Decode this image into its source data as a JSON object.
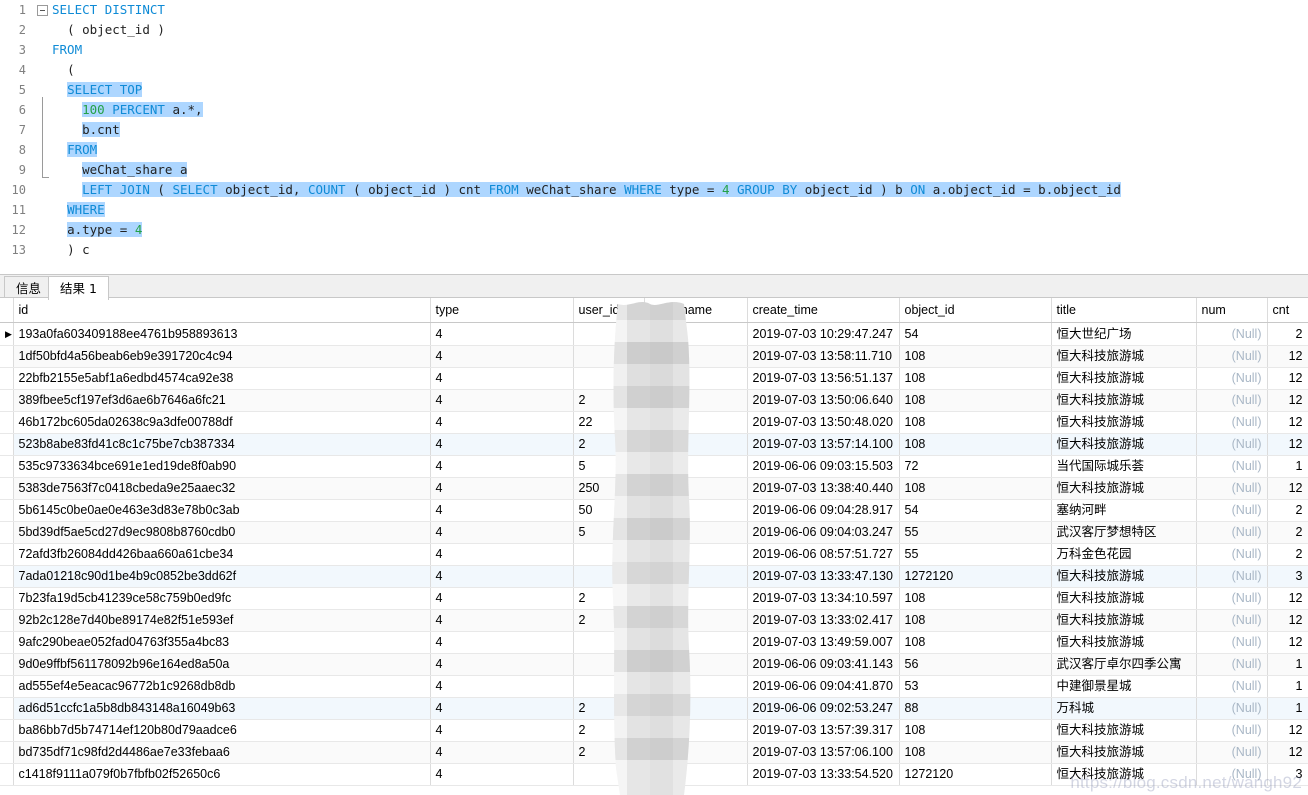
{
  "editor": {
    "language": "sql",
    "lines": [
      {
        "n": "1",
        "text": "SELECT DISTINCT"
      },
      {
        "n": "2",
        "text": "  ( object_id )"
      },
      {
        "n": "3",
        "text": "FROM"
      },
      {
        "n": "4",
        "text": "  ("
      },
      {
        "n": "5",
        "text": "  SELECT TOP"
      },
      {
        "n": "6",
        "text": "    100 PERCENT a.*,"
      },
      {
        "n": "7",
        "text": "    b.cnt"
      },
      {
        "n": "8",
        "text": "  FROM"
      },
      {
        "n": "9",
        "text": "    weChat_share a"
      },
      {
        "n": "10",
        "text": "    LEFT JOIN ( SELECT object_id, COUNT ( object_id ) cnt FROM weChat_share WHERE type = 4 GROUP BY object_id ) b ON a.object_id = b.object_id"
      },
      {
        "n": "11",
        "text": "  WHERE"
      },
      {
        "n": "12",
        "text": "  a.type = 4"
      },
      {
        "n": "13",
        "text": "  ) c"
      }
    ]
  },
  "tabs": [
    {
      "label": "信息",
      "active": false
    },
    {
      "label": "结果 1",
      "active": true
    }
  ],
  "grid": {
    "columns": [
      "id",
      "type",
      "user_id",
      "user_name",
      "create_time",
      "object_id",
      "title",
      "num",
      "cnt"
    ],
    "selected_column": "id",
    "current_row_marker": "▶",
    "null_text": "(Null)",
    "rows": [
      {
        "id": "193a0fa603409188ee4761b958893613",
        "type": "4",
        "user_id": "",
        "user_name": "",
        "create_time": "2019-07-03 10:29:47.247",
        "object_id": "54",
        "title": "恒大世纪广场",
        "num": "(Null)",
        "cnt": "2"
      },
      {
        "id": "1df50bfd4a56beab6eb9e391720c4c94",
        "type": "4",
        "user_id": "",
        "user_name": "",
        "create_time": "2019-07-03 13:58:11.710",
        "object_id": "108",
        "title": "恒大科技旅游城",
        "num": "(Null)",
        "cnt": "12"
      },
      {
        "id": "22bfb2155e5abf1a6edbd4574ca92e38",
        "type": "4",
        "user_id": "",
        "user_name": "",
        "create_time": "2019-07-03 13:56:51.137",
        "object_id": "108",
        "title": "恒大科技旅游城",
        "num": "(Null)",
        "cnt": "12"
      },
      {
        "id": "389fbee5cf197ef3d6ae6b7646a6fc21",
        "type": "4",
        "user_id": "2",
        "user_name": "",
        "create_time": "2019-07-03 13:50:06.640",
        "object_id": "108",
        "title": "恒大科技旅游城",
        "num": "(Null)",
        "cnt": "12"
      },
      {
        "id": "46b172bc605da02638c9a3dfe00788df",
        "type": "4",
        "user_id": "22",
        "user_name": "",
        "create_time": "2019-07-03 13:50:48.020",
        "object_id": "108",
        "title": "恒大科技旅游城",
        "num": "(Null)",
        "cnt": "12"
      },
      {
        "id": "523b8abe83fd41c8c1c75be7cb387334",
        "type": "4",
        "user_id": "2",
        "user_name": "",
        "create_time": "2019-07-03 13:57:14.100",
        "object_id": "108",
        "title": "恒大科技旅游城",
        "num": "(Null)",
        "cnt": "12"
      },
      {
        "id": "535c9733634bce691e1ed19de8f0ab90",
        "type": "4",
        "user_id": "5",
        "user_name": "",
        "create_time": "2019-06-06 09:03:15.503",
        "object_id": "72",
        "title": "当代国际城乐荟",
        "num": "(Null)",
        "cnt": "1"
      },
      {
        "id": "5383de7563f7c0418cbeda9e25aaec32",
        "type": "4",
        "user_id": "250",
        "user_name": "",
        "create_time": "2019-07-03 13:38:40.440",
        "object_id": "108",
        "title": "恒大科技旅游城",
        "num": "(Null)",
        "cnt": "12"
      },
      {
        "id": "5b6145c0be0ae0e463e3d83e78b0c3ab",
        "type": "4",
        "user_id": "50",
        "user_name": "",
        "create_time": "2019-06-06 09:04:28.917",
        "object_id": "54",
        "title": "塞纳河畔",
        "num": "(Null)",
        "cnt": "2"
      },
      {
        "id": "5bd39df5ae5cd27d9ec9808b8760cdb0",
        "type": "4",
        "user_id": "5",
        "user_name": "",
        "create_time": "2019-06-06 09:04:03.247",
        "object_id": "55",
        "title": "武汉客厅梦想特区",
        "num": "(Null)",
        "cnt": "2"
      },
      {
        "id": "72afd3fb26084dd426baa660a61cbe34",
        "type": "4",
        "user_id": "",
        "user_name": "",
        "create_time": "2019-06-06 08:57:51.727",
        "object_id": "55",
        "title": "万科金色花园",
        "num": "(Null)",
        "cnt": "2"
      },
      {
        "id": "7ada01218c90d1be4b9c0852be3dd62f",
        "type": "4",
        "user_id": "",
        "user_name": "",
        "create_time": "2019-07-03 13:33:47.130",
        "object_id": "1272120",
        "title": "恒大科技旅游城",
        "num": "(Null)",
        "cnt": "3"
      },
      {
        "id": "7b23fa19d5cb41239ce58c759b0ed9fc",
        "type": "4",
        "user_id": "2",
        "user_name": "",
        "create_time": "2019-07-03 13:34:10.597",
        "object_id": "108",
        "title": "恒大科技旅游城",
        "num": "(Null)",
        "cnt": "12"
      },
      {
        "id": "92b2c128e7d40be89174e82f51e593ef",
        "type": "4",
        "user_id": "2",
        "user_name": "",
        "create_time": "2019-07-03 13:33:02.417",
        "object_id": "108",
        "title": "恒大科技旅游城",
        "num": "(Null)",
        "cnt": "12"
      },
      {
        "id": "9afc290beae052fad04763f355a4bc83",
        "type": "4",
        "user_id": "",
        "user_name": "",
        "create_time": "2019-07-03 13:49:59.007",
        "object_id": "108",
        "title": "恒大科技旅游城",
        "num": "(Null)",
        "cnt": "12"
      },
      {
        "id": "9d0e9ffbf561178092b96e164ed8a50a",
        "type": "4",
        "user_id": "",
        "user_name": "",
        "create_time": "2019-06-06 09:03:41.143",
        "object_id": "56",
        "title": "武汉客厅卓尔四季公寓",
        "num": "(Null)",
        "cnt": "1"
      },
      {
        "id": "ad555ef4e5eacac96772b1c9268db8db",
        "type": "4",
        "user_id": "",
        "user_name": "",
        "create_time": "2019-06-06 09:04:41.870",
        "object_id": "53",
        "title": "中建御景星城",
        "num": "(Null)",
        "cnt": "1"
      },
      {
        "id": "ad6d51ccfc1a5b8db843148a16049b63",
        "type": "4",
        "user_id": "2",
        "user_name": "",
        "create_time": "2019-06-06 09:02:53.247",
        "object_id": "88",
        "title": "万科城",
        "num": "(Null)",
        "cnt": "1"
      },
      {
        "id": "ba86bb7d5b74714ef120b80d79aadce6",
        "type": "4",
        "user_id": "2",
        "user_name": "",
        "create_time": "2019-07-03 13:57:39.317",
        "object_id": "108",
        "title": "恒大科技旅游城",
        "num": "(Null)",
        "cnt": "12"
      },
      {
        "id": "bd735df71c98fd2d4486ae7e33febaa6",
        "type": "4",
        "user_id": "2",
        "user_name": "",
        "create_time": "2019-07-03 13:57:06.100",
        "object_id": "108",
        "title": "恒大科技旅游城",
        "num": "(Null)",
        "cnt": "12"
      },
      {
        "id": "c1418f9111a079f0b7fbfb02f52650c6",
        "type": "4",
        "user_id": "",
        "user_name": "",
        "create_time": "2019-07-03 13:33:54.520",
        "object_id": "1272120",
        "title": "恒大科技旅游城",
        "num": "(Null)",
        "cnt": "3"
      }
    ]
  },
  "watermark": {
    "text": "https://blog.csdn.net/wangh92"
  },
  "colors": {
    "selection": "#add6ff",
    "keyword": "#0f8bd6",
    "number": "#24a148",
    "header_selected": "#dce9f7",
    "null_text": "#a9b7c6"
  }
}
